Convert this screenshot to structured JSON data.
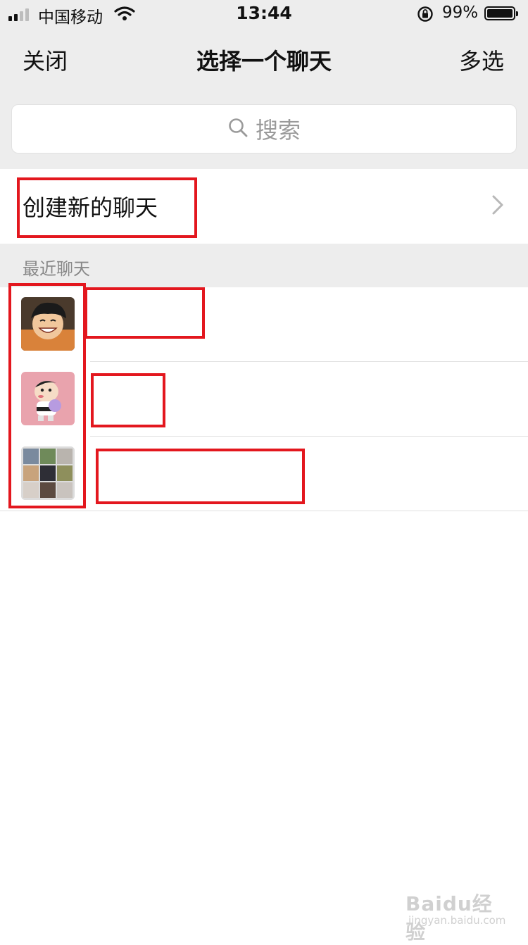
{
  "status_bar": {
    "carrier": "中国移动",
    "time": "13:44",
    "battery_percent": "99%",
    "signal_bars_filled": 2,
    "signal_bars_total": 4
  },
  "nav": {
    "left_label": "关闭",
    "title": "选择一个聊天",
    "right_label": "多选"
  },
  "search": {
    "placeholder": "搜索",
    "icon": "search-icon"
  },
  "create_new": {
    "label": "创建新的聊天",
    "icon": "chevron-right-icon"
  },
  "recent_section": {
    "label": "最近聊天"
  },
  "recent_chats": [
    {
      "name": "",
      "avatar": "cartoon-pirate-avatar"
    },
    {
      "name": "",
      "avatar": "cartoon-boy-avatar"
    },
    {
      "name": "",
      "avatar": "group-grid-avatar"
    }
  ],
  "watermark": {
    "brand": "Baidu经验",
    "url": "jingyan.baidu.com"
  },
  "colors": {
    "highlight": "#e3171e",
    "header_bg": "#ededed",
    "chevron": "#b8b8b8"
  }
}
